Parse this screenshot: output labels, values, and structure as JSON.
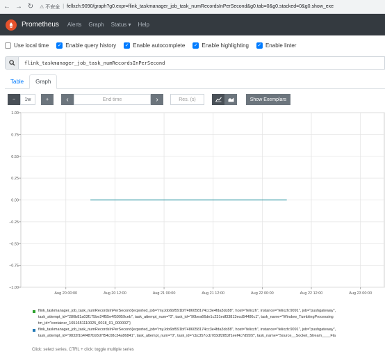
{
  "browser": {
    "security_label": "不安全",
    "host": "fellxzh:9090",
    "url_path": "/graph?g0.expr=flink_taskmanager_job_task_numRecordsInPerSecond&g0.tab=0&g0.stacked=0&g0.show_exe",
    "back_icon": "back-arrow-icon",
    "forward_icon": "forward-arrow-icon",
    "reload_icon": "reload-icon"
  },
  "navbar": {
    "brand": "Prometheus",
    "links": [
      "Alerts",
      "Graph",
      "Status ▾",
      "Help"
    ],
    "bg_color": "#343a40",
    "logo_color": "#e6522c"
  },
  "options": [
    {
      "label": "Use local time",
      "checked": false
    },
    {
      "label": "Enable query history",
      "checked": true
    },
    {
      "label": "Enable autocomplete",
      "checked": true
    },
    {
      "label": "Enable highlighting",
      "checked": true
    },
    {
      "label": "Enable linter",
      "checked": true
    }
  ],
  "query": {
    "expression": "flink_taskmanager_job_task_numRecordsInPerSecond",
    "icon": "search-icon"
  },
  "tabs": {
    "table": "Table",
    "graph": "Graph",
    "active": "Graph"
  },
  "controls": {
    "minus": "−",
    "range": "1w",
    "plus": "+",
    "prev": "‹",
    "end_time_placeholder": "End time",
    "next": "›",
    "resolution_placeholder": "Res. (s)",
    "show_exemplars": "Show Exemplars"
  },
  "chart_data": {
    "type": "line",
    "y_ticks": [
      "1.00",
      "0.75",
      "0.50",
      "0.25",
      "0.00",
      "−0.25",
      "−0.50",
      "−0.75",
      "−1.00"
    ],
    "ylim": [
      -1,
      1
    ],
    "x_ticks": [
      "Aug 20 00:00",
      "Aug 20 12:00",
      "Aug 21 00:00",
      "Aug 21 12:00",
      "Aug 22 00:00",
      "Aug 22 12:00",
      "Aug 23 00:00"
    ],
    "grid": true,
    "series": [
      {
        "color": "#3b9da8",
        "x": [
          "Aug 20 06:00",
          "Aug 22 06:00"
        ],
        "values": [
          0,
          0
        ]
      }
    ]
  },
  "legend": [
    {
      "color": "#2ca02c",
      "lines": [
        "flink_taskmanager_job_task_numRecordsInPerSecond{exported_job=\"myJob6bf591bf7486058174cc3e4fda3dc88\", host=\"felixzh\", instance=\"felixzh:9091\", job=\"pushgateway\",",
        "task_attempt_id=\"280b81a03f175be24f55e4f50059ceb\", task_attempt_num=\"0\", task_id=\"90bea66de1c231edf33813ecd54486c1\", task_name=\"Window_TumblingProcessing",
        "tm_id=\"container_1651651110025_0018_01_000002\"}"
      ]
    },
    {
      "color": "#1f77b4",
      "lines": [
        "flink_taskmanager_job_task_numRecordsInPerSecond{exported_job=\"myJob6bf591bf7486058174cc3e4fda3dc88\", host=\"felixzh\", instance=\"felixzh:9091\", job=\"pushgateway\",",
        "task_attempt_id=\"9833f1b4f487b93d7f54c08c34a86841\", task_attempt_num=\"0\", task_id=\"cbc357ccb783df2852f1eef4c7d55f2\", task_name=\"Source__Socket_Stream____Fla"
      ]
    }
  ],
  "legend_hint": "Click: select series, CTRL + click: toggle multiple series"
}
